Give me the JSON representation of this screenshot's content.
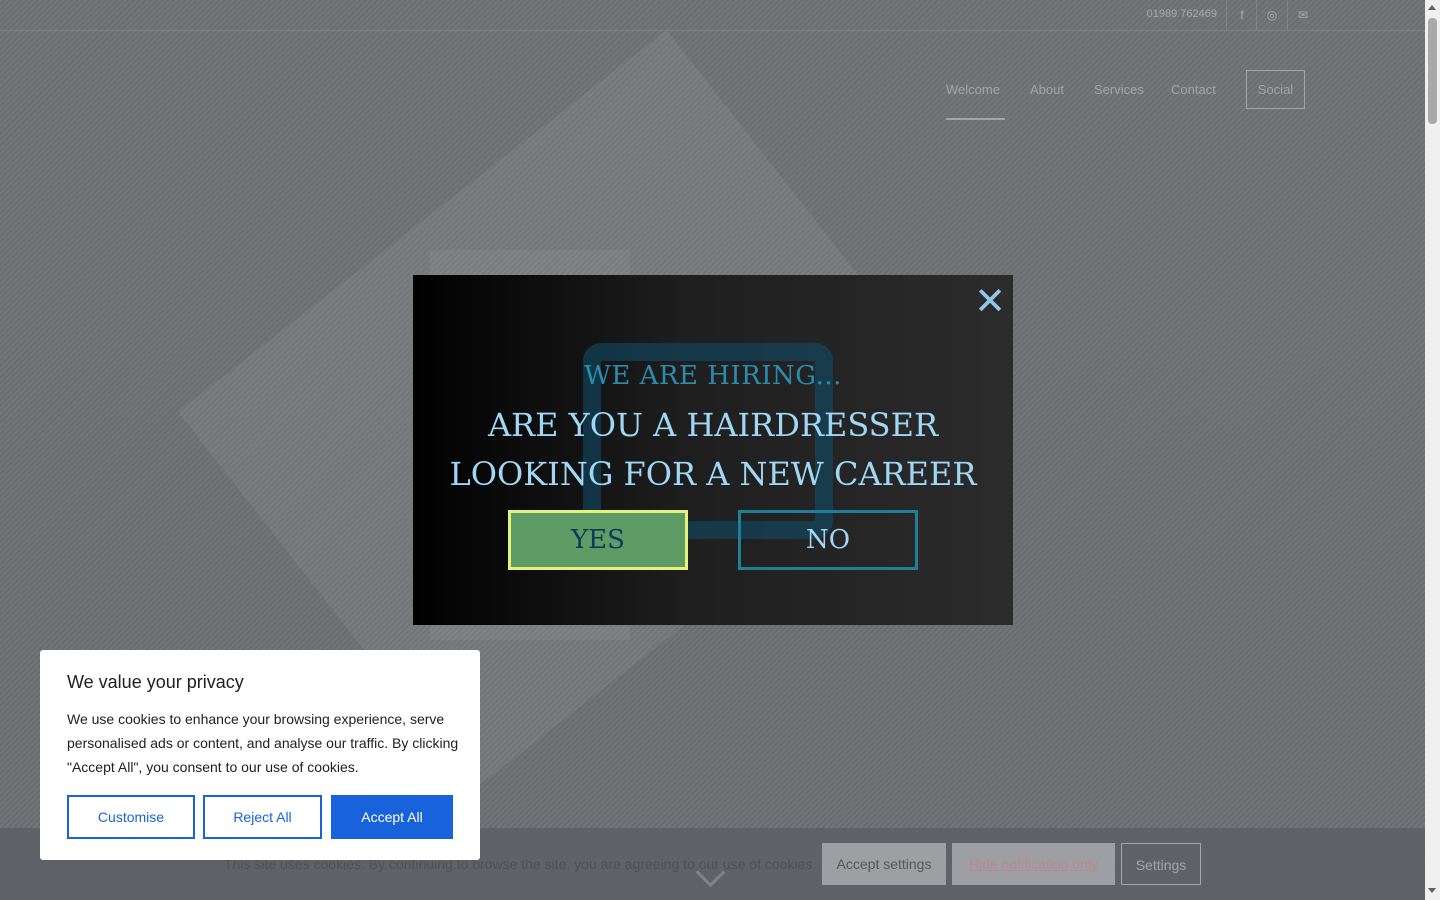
{
  "topbar": {
    "phone": "01989 762469",
    "icons": [
      "facebook-icon",
      "instagram-icon",
      "mail-icon"
    ]
  },
  "nav": {
    "items": [
      {
        "label": "Welcome",
        "active": true
      },
      {
        "label": "About"
      },
      {
        "label": "Services"
      },
      {
        "label": "Contact"
      }
    ],
    "social_label": "Social"
  },
  "modal": {
    "kicker": "WE ARE HIRING...",
    "title_line1": "ARE YOU A HAIRDRESSER",
    "title_line2": "LOOKING FOR A NEW CAREER",
    "yes_label": "YES",
    "no_label": "NO",
    "close_glyph": "✕"
  },
  "cookie_bar": {
    "text": "This site uses cookies. By continuing to browse the site, you are agreeing to our use of cookies.",
    "accept_settings": "Accept settings",
    "hide_notification": "Hide notification only",
    "settings": "Settings"
  },
  "privacy": {
    "title": "We value your privacy",
    "text": "We use cookies to enhance your browsing experience, serve personalised ads or content, and analyse our traffic. By clicking \"Accept All\", you consent to our use of cookies.",
    "customise": "Customise",
    "reject_all": "Reject All",
    "accept_all": "Accept All"
  },
  "colors": {
    "accent_blue": "#1863dc",
    "modal_title": "#9fd7f5",
    "modal_kicker": "#2a8db0",
    "yes_bg": "#5e9c66",
    "yes_border": "#e6f07a"
  }
}
